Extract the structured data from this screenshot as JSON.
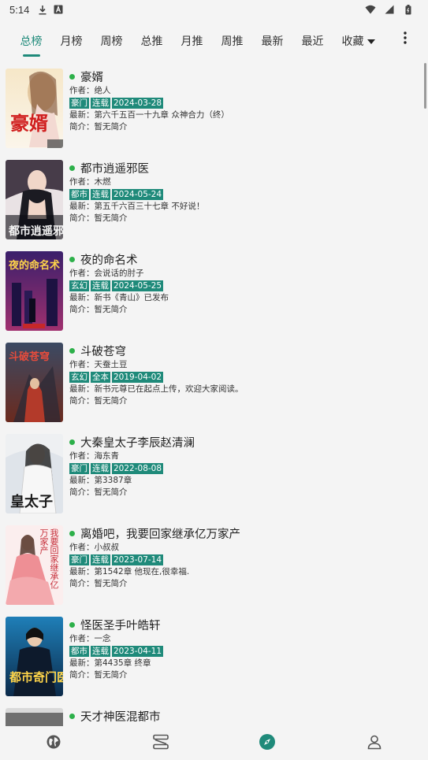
{
  "status_bar": {
    "time": "5:14",
    "icons": [
      "download-icon",
      "font-icon",
      "wifi-icon",
      "signal-icon",
      "battery-icon"
    ]
  },
  "tabs": [
    {
      "label": "总榜",
      "active": true
    },
    {
      "label": "月榜",
      "active": false
    },
    {
      "label": "周榜",
      "active": false
    },
    {
      "label": "总推",
      "active": false
    },
    {
      "label": "月推",
      "active": false
    },
    {
      "label": "周推",
      "active": false
    },
    {
      "label": "最新",
      "active": false
    },
    {
      "label": "最近",
      "active": false
    },
    {
      "label": "收藏",
      "active": false
    }
  ],
  "colors": {
    "accent": "#1f8a7a",
    "dot": "#2db04a"
  },
  "books": [
    {
      "title": "豪婿",
      "author": "作者：绝人",
      "tags": [
        "豪门",
        "连载",
        "2024-03-28"
      ],
      "latest": "最新：第六千五百一十九章 众神合力（终）",
      "intro": "简介：暂无简介",
      "cover_text": "豪婿"
    },
    {
      "title": "都市逍遥邪医",
      "author": "作者：木燃",
      "tags": [
        "都市",
        "连载",
        "2024-05-24"
      ],
      "latest": "最新：第五千六百三十七章 不好说！",
      "intro": "简介：暂无简介",
      "cover_text": "都市逍遥邪医"
    },
    {
      "title": "夜的命名术",
      "author": "作者：会说话的肘子",
      "tags": [
        "玄幻",
        "连载",
        "2024-05-25"
      ],
      "latest": "最新：新书《青山》已发布",
      "intro": "简介：暂无简介",
      "cover_text": "夜的命名术"
    },
    {
      "title": "斗破苍穹",
      "author": "作者：天蚕土豆",
      "tags": [
        "玄幻",
        "全本",
        "2019-04-02"
      ],
      "latest": "最新：新书元尊已在起点上传，欢迎大家阅读。",
      "intro": "简介：暂无简介",
      "cover_text": "斗破苍穹"
    },
    {
      "title": "大秦皇太子李辰赵清澜",
      "author": "作者：海东青",
      "tags": [
        "豪门",
        "连载",
        "2022-08-08"
      ],
      "latest": "最新：第3387章",
      "intro": "简介：暂无简介",
      "cover_text": "皇太子"
    },
    {
      "title": "离婚吧，我要回家继承亿万家产",
      "author": "作者：小叔叔",
      "tags": [
        "豪门",
        "连载",
        "2023-07-14"
      ],
      "latest": "最新：第1542章 他现在,很幸福.",
      "intro": "简介：暂无简介",
      "cover_text": "我要回家继承亿万家产"
    },
    {
      "title": "怪医圣手叶皓轩",
      "author": "作者：一念",
      "tags": [
        "都市",
        "连载",
        "2023-04-11"
      ],
      "latest": "最新：第4435章 终章",
      "intro": "简介：暂无简介",
      "cover_text": "都市奇门医圣"
    },
    {
      "title": "天才神医混都市",
      "author": "",
      "tags": [],
      "latest": "",
      "intro": "",
      "cover_text": ""
    }
  ],
  "bottom_nav": [
    {
      "name": "discover",
      "icon": "globe-icon",
      "active": false
    },
    {
      "name": "bookshelf",
      "icon": "bookshelf-icon",
      "active": false
    },
    {
      "name": "explore",
      "icon": "compass-icon",
      "active": true
    },
    {
      "name": "profile",
      "icon": "person-icon",
      "active": false
    }
  ]
}
